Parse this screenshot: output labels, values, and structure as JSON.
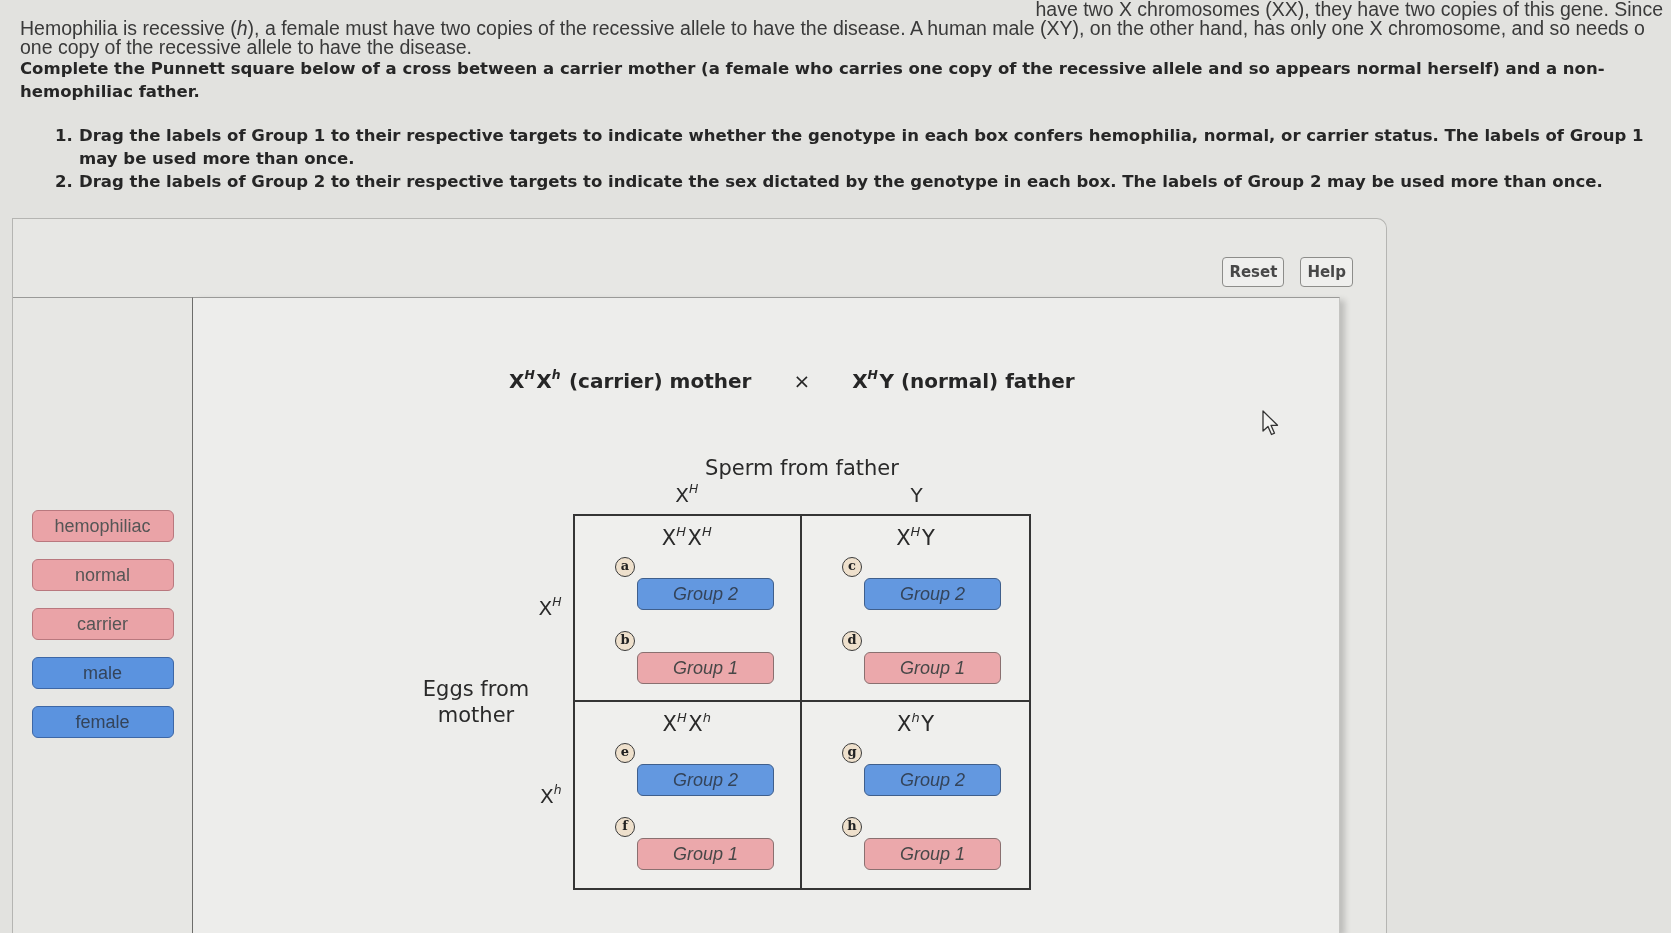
{
  "intro": {
    "top_fragment": "have two X chromosomes (XX), they have two copies of this gene. Since",
    "lines": [
      "Hemophilia is recessive (*h*), a female must have two copies of the recessive allele to have the disease. A human male (XY), on the other hand, has only one X chromosome, and so needs o",
      "one copy of the recessive allele to have the disease."
    ]
  },
  "instructions": {
    "text": "Complete the Punnett square below of a cross between a carrier mother (a female who carries one copy of the recessive allele and so appears normal herself) and a non-hemophiliac father.",
    "steps": [
      {
        "number": "1.",
        "text": "Drag the labels of Group 1 to their respective targets to indicate whether the genotype in each box confers hemophilia, normal, or carrier status. The labels of Group 1 may be used more than once."
      },
      {
        "number": "2.",
        "text": "Drag the labels of Group 2 to their respective targets to indicate the sex dictated by the genotype in each box. The labels of Group 2 may be used more than once."
      }
    ]
  },
  "toolbar": {
    "buttons": [
      "Reset",
      "Help"
    ]
  },
  "label_palette": [
    {
      "label": "hemophiliac",
      "kind": "group1"
    },
    {
      "label": "normal",
      "kind": "group1"
    },
    {
      "label": "carrier",
      "kind": "group1"
    },
    {
      "label": "male",
      "kind": "group2"
    },
    {
      "label": "female",
      "kind": "group2"
    }
  ],
  "cross": {
    "mother": "X$^{H}$X$^{h}$ (carrier) mother",
    "operator": "×",
    "father": "X$^{H}$Y (normal) father"
  },
  "punnett_square": {
    "column_title": "Sperm from father",
    "columns": [
      "X$^{H}$",
      "Y"
    ],
    "row_title": "Eggs from mother",
    "rows": [
      {
        "header": "X$^{H}$",
        "cells": [
          {
            "genotype": "X$^{H}$X$^{H}$",
            "targets": [
              {
                "marker": "a",
                "label": "Group 2",
                "kind": "group2"
              },
              {
                "marker": "b",
                "label": "Group 1",
                "kind": "group1"
              }
            ]
          },
          {
            "genotype": "X$^{H}$Y",
            "targets": [
              {
                "marker": "c",
                "label": "Group 2",
                "kind": "group2"
              },
              {
                "marker": "d",
                "label": "Group 1",
                "kind": "group1"
              }
            ]
          }
        ]
      },
      {
        "header": "X$^{h}$",
        "cells": [
          {
            "genotype": "X$^{H}$X$^{h}$",
            "targets": [
              {
                "marker": "e",
                "label": "Group 2",
                "kind": "group2"
              },
              {
                "marker": "f",
                "label": "Group 1",
                "kind": "group1"
              }
            ]
          },
          {
            "genotype": "X$^{h}$Y",
            "targets": [
              {
                "marker": "g",
                "label": "Group 2",
                "kind": "group2"
              },
              {
                "marker": "h",
                "label": "Group 1",
                "kind": "group1"
              }
            ]
          }
        ]
      }
    ]
  }
}
